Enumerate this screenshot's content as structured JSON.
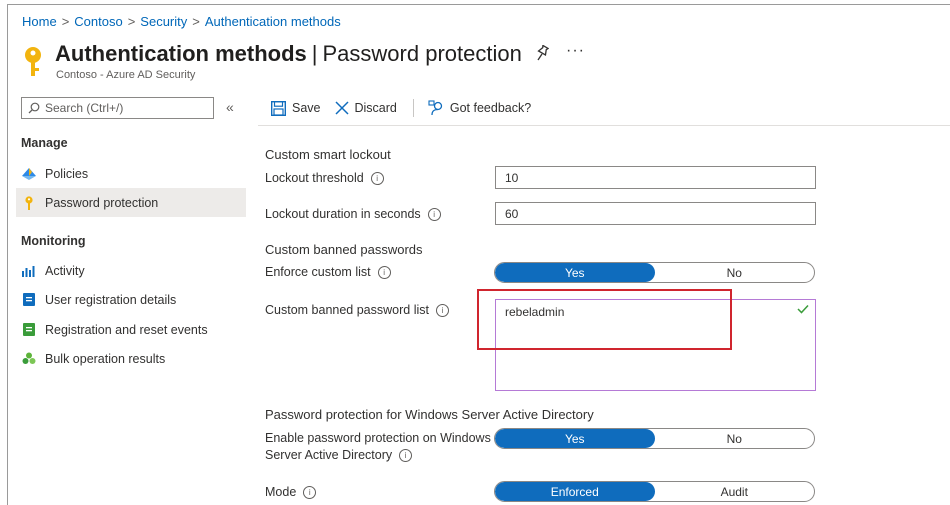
{
  "breadcrumb": [
    "Home",
    "Contoso",
    "Security",
    "Authentication methods"
  ],
  "header": {
    "title_bold": "Authentication methods",
    "title_separator": "|",
    "title_rest": "Password protection",
    "subtitle": "Contoso - Azure AD Security",
    "more": "···"
  },
  "sidebar": {
    "search_placeholder": "Search (Ctrl+/)",
    "collapse": "«",
    "sections": [
      {
        "title": "Manage",
        "items": [
          {
            "label": "Policies",
            "icon": "policies-icon"
          },
          {
            "label": "Password protection",
            "icon": "key-icon",
            "active": true
          }
        ]
      },
      {
        "title": "Monitoring",
        "items": [
          {
            "label": "Activity",
            "icon": "activity-icon"
          },
          {
            "label": "User registration details",
            "icon": "user-registration-icon"
          },
          {
            "label": "Registration and reset events",
            "icon": "registration-events-icon"
          },
          {
            "label": "Bulk operation results",
            "icon": "bulk-operation-icon"
          }
        ]
      }
    ]
  },
  "toolbar": {
    "save": "Save",
    "discard": "Discard",
    "feedback": "Got feedback?"
  },
  "form": {
    "smart_lockout_header": "Custom smart lockout",
    "lockout_threshold_label": "Lockout threshold",
    "lockout_threshold_value": "10",
    "lockout_duration_label": "Lockout duration in seconds",
    "lockout_duration_value": "60",
    "banned_passwords_header": "Custom banned passwords",
    "enforce_custom_list_label": "Enforce custom list",
    "enforce_custom_list": {
      "yes": "Yes",
      "no": "No",
      "selected": "Yes"
    },
    "banned_list_label": "Custom banned password list",
    "banned_list_value": "rebeladmin",
    "windows_header": "Password protection for Windows Server Active Directory",
    "enable_windows_label_line1": "Enable password protection on Windows",
    "enable_windows_label_line2": "Server Active Directory",
    "enable_windows": {
      "yes": "Yes",
      "no": "No",
      "selected": "Yes"
    },
    "mode_label": "Mode",
    "mode": {
      "enforced": "Enforced",
      "audit": "Audit",
      "selected": "Enforced"
    },
    "info_glyph": "i"
  },
  "colors": {
    "accent": "#0f6cbd",
    "link": "#0067b8",
    "highlight": "#d0252e",
    "key": "#f2b40f"
  }
}
